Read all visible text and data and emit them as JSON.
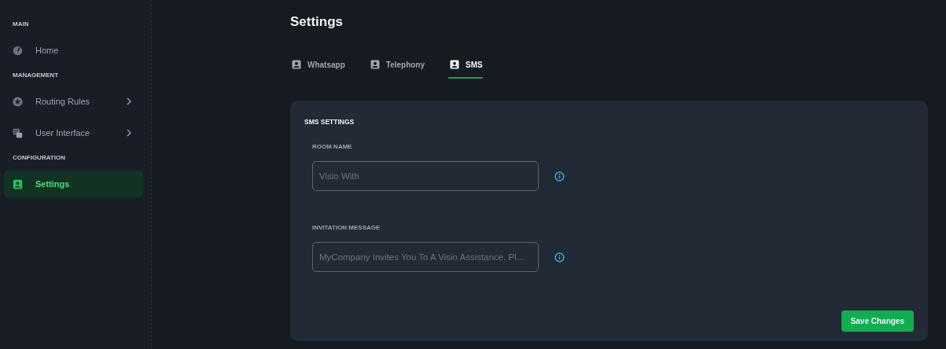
{
  "sidebar": {
    "sections": [
      {
        "heading": "MAIN",
        "items": [
          {
            "label": "Home",
            "has_submenu": false,
            "selected": false
          }
        ]
      },
      {
        "heading": "MANAGEMENT",
        "items": [
          {
            "label": "Routing Rules",
            "has_submenu": true,
            "selected": false
          },
          {
            "label": "User Interface",
            "has_submenu": true,
            "selected": false
          }
        ]
      },
      {
        "heading": "CONFIGURATION",
        "items": [
          {
            "label": "Settings",
            "has_submenu": false,
            "selected": true
          }
        ]
      }
    ]
  },
  "page_title": "Settings",
  "tabs": [
    {
      "label": "Whatsapp",
      "selected": false
    },
    {
      "label": "Telephony",
      "selected": false
    },
    {
      "label": "SMS",
      "selected": true
    }
  ],
  "card": {
    "title": "SMS SETTINGS",
    "fields": [
      {
        "label": "ROOM NAME",
        "placeholder": "Visio With"
      },
      {
        "label": "INVITATION MESSAGE",
        "placeholder": "MyCompany Invites You To A Visio Assistance. Pl..."
      }
    ],
    "button": "Save Changes"
  }
}
